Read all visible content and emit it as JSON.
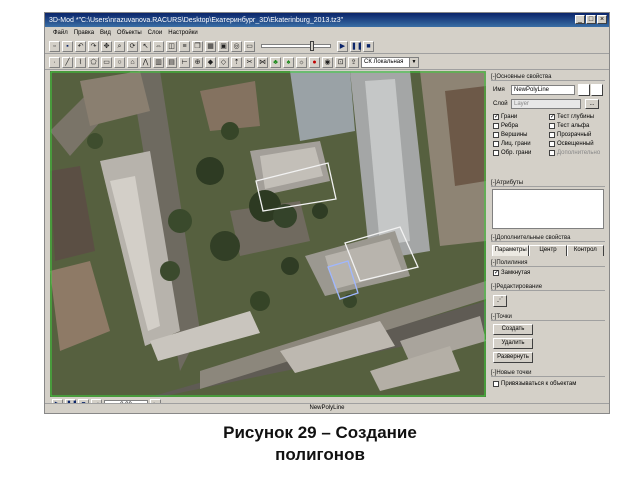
{
  "window": {
    "title": "3D-Mod *\"C:\\Users\\nrazuvanova.RACURS\\Desktop\\Екатеринбург_3D\\Ekaterinburg_2013.tz3\""
  },
  "menu": [
    "Файл",
    "Правка",
    "Вид",
    "Объекты",
    "Слои",
    "Настройки"
  ],
  "toolbar": {
    "coord_system": "СК Локальная"
  },
  "playback": {
    "position": "0.00"
  },
  "status": {
    "object_name": "NewPolyLine"
  },
  "panel": {
    "basic": {
      "title": "[-]Основные свойства",
      "name_label": "Имя",
      "name_value": "NewPolyLine",
      "layer_label": "Слой",
      "layer_value": "Layer",
      "checkboxes": [
        {
          "label": "Грани",
          "checked": "✓"
        },
        {
          "label": "Тест глубины",
          "checked": "✓"
        },
        {
          "label": "Ребра",
          "checked": ""
        },
        {
          "label": "Тест альфа",
          "checked": ""
        },
        {
          "label": "Вершины",
          "checked": ""
        },
        {
          "label": "Прозрачный",
          "checked": ""
        },
        {
          "label": "Лиц. грани",
          "checked": ""
        },
        {
          "label": "Освещенный",
          "checked": ""
        },
        {
          "label": "Обр. грани",
          "checked": ""
        },
        {
          "label": "Дополнительно",
          "checked": ""
        }
      ]
    },
    "attributes": {
      "title": "[-]Атрибуты"
    },
    "extra": {
      "title": "[-]Дополнительные свойства",
      "tabs": [
        "Параметры",
        "Центр",
        "Контрол"
      ]
    },
    "polyline": {
      "title": "[-]Полилиния",
      "closed_label": "Замкнутая",
      "closed_checked": "✓"
    },
    "editing": {
      "title": "[-]Редактирование"
    },
    "points": {
      "title": "[-]Точки",
      "buttons": [
        "Создать",
        "Удалить",
        "Развернуть"
      ]
    },
    "new_points": {
      "title": "[-]Новые точки",
      "snap_label": "Привязываться к объектам"
    }
  },
  "caption": {
    "line1": "Рисунок 29 – Создание",
    "line2": "полигонов"
  }
}
